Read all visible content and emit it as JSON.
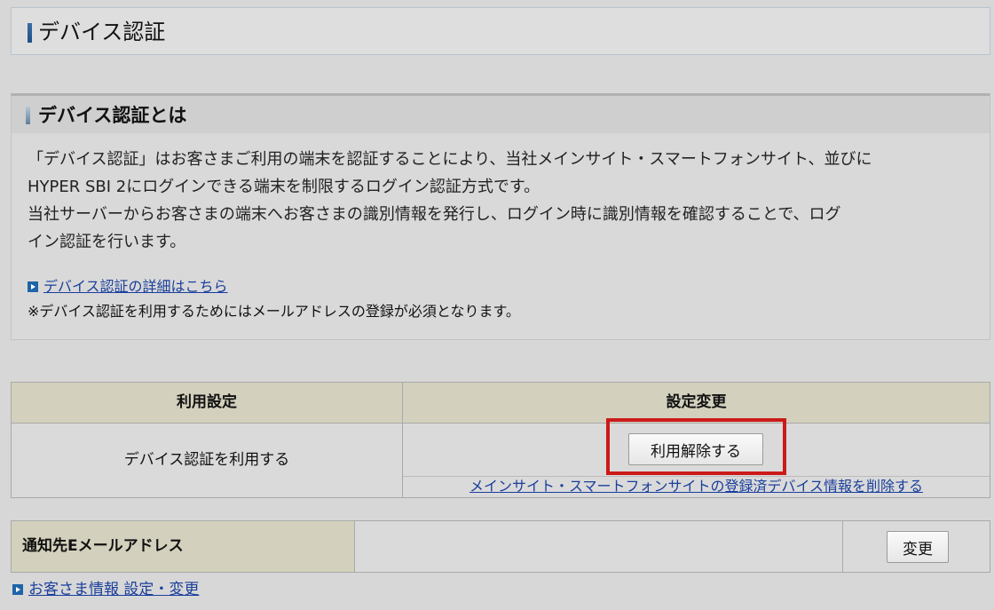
{
  "page": {
    "title": "デバイス認証"
  },
  "about": {
    "heading": "デバイス認証とは",
    "paragraph_lines": [
      "「デバイス認証」はお客さまご利用の端末を認証することにより、当社メインサイト・スマートフォンサイト、並びに",
      "HYPER SBI 2にログインできる端末を制限するログイン認証方式です。",
      "当社サーバーからお客さまの端末へお客さまの識別情報を発行し、ログイン時に識別情報を確認することで、ログ",
      "イン認証を行います。"
    ],
    "detail_link": "デバイス認証の詳細はこちら",
    "note": "※デバイス認証を利用するためにはメールアドレスの登録が必須となります。"
  },
  "settings": {
    "col_usage_header": "利用設定",
    "col_change_header": "設定変更",
    "usage_value": "デバイス認証を利用する",
    "release_button": "利用解除する",
    "delete_link": "メインサイト・スマートフォンサイトの登録済デバイス情報を削除する"
  },
  "email": {
    "label": "通知先Eメールアドレス",
    "value": "",
    "change_button": "変更"
  },
  "footer": {
    "customer_link": "お客さま情報 設定・変更"
  },
  "colors": {
    "accent_blue": "#1f63a8",
    "link": "#1a3f9c",
    "highlight": "#cc1a1a",
    "table_header": "#d3d1bd"
  },
  "icons": {
    "title_marker": "title-marker-icon",
    "section_marker": "section-marker-icon",
    "link_arrow": "arrow-right-square-icon"
  }
}
